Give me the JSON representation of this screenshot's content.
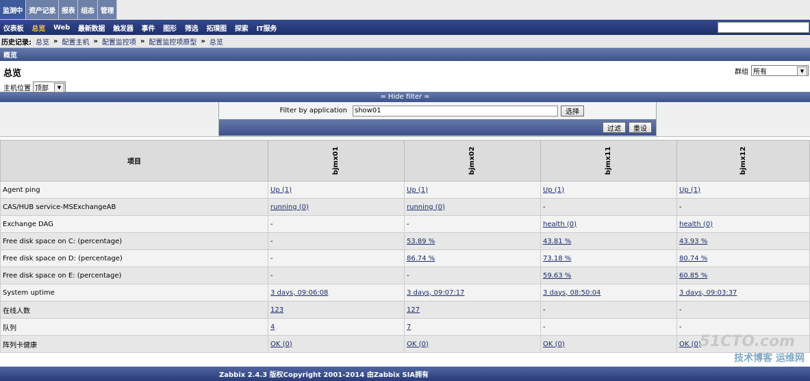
{
  "top_menu": [
    "监测中",
    "资产记录",
    "报表",
    "组态",
    "管理"
  ],
  "sub_menu": [
    "仪表板",
    "总览",
    "Web",
    "最新数据",
    "触发器",
    "事件",
    "图形",
    "筛选",
    "拓璞图",
    "探索",
    "IT服务"
  ],
  "history": {
    "label": "历史记录:",
    "items": [
      "总览",
      "配置主机",
      "配置监控项",
      "配置监控项原型",
      "总览"
    ]
  },
  "section_bar": "概览",
  "page": {
    "title": "总览",
    "host_location_label": "主机位置",
    "host_location_value": "顶部",
    "group_label": "群组",
    "group_value": "所有"
  },
  "filter": {
    "toggle_label": "≈ Hide filter ≈",
    "app_label": "Filter by application",
    "app_value": "show01",
    "select_button": "选择",
    "filter_button": "过滤",
    "reset_button": "重设"
  },
  "table": {
    "item_header": "项目",
    "hosts": [
      "bjmx01",
      "bjmx02",
      "bjmx11",
      "bjmx12"
    ],
    "rows": [
      {
        "item": "Agent ping",
        "values": [
          "Up (1)",
          "Up (1)",
          "Up (1)",
          "Up (1)"
        ]
      },
      {
        "item": "CAS/HUB service-MSExchangeAB",
        "values": [
          "running (0)",
          "running (0)",
          "-",
          "-"
        ]
      },
      {
        "item": "Exchange DAG",
        "values": [
          "-",
          "-",
          "health (0)",
          "health (0)"
        ]
      },
      {
        "item": "Free disk space on C: (percentage)",
        "values": [
          "-",
          "53.89 %",
          "43.81 %",
          "43.93 %"
        ]
      },
      {
        "item": "Free disk space on D: (percentage)",
        "values": [
          "-",
          "86.74 %",
          "73.18 %",
          "80.74 %"
        ]
      },
      {
        "item": "Free disk space on E: (percentage)",
        "values": [
          "-",
          "-",
          "59.63 %",
          "60.85 %"
        ]
      },
      {
        "item": "System uptime",
        "values": [
          "3 days, 09:06:08",
          "3 days, 09:07:17",
          "3 days, 08:50:04",
          "3 days, 09:03:37"
        ]
      },
      {
        "item": "在线人数",
        "values": [
          "123",
          "127",
          "-",
          "-"
        ]
      },
      {
        "item": "队列",
        "values": [
          "4",
          "7",
          "-",
          "-"
        ]
      },
      {
        "item": "阵列卡健康",
        "values": [
          "OK (0)",
          "OK (0)",
          "OK (0)",
          "OK (0)"
        ]
      }
    ]
  },
  "footer": "Zabbix 2.4.3 版权Copyright 2001-2014 由Zabbix SIA拥有",
  "watermark": {
    "main": "51CTO.com",
    "sub": "技术博客 运维网"
  }
}
